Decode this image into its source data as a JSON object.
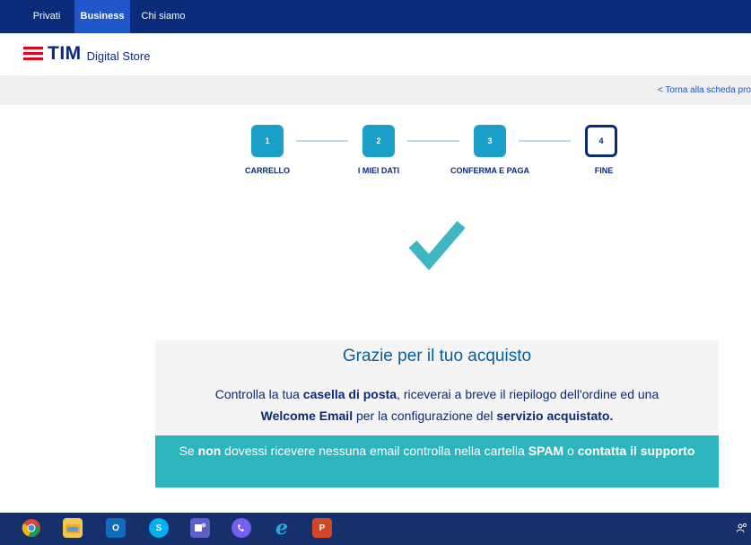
{
  "topnav": {
    "tabs": [
      {
        "label": "Privati"
      },
      {
        "label": "Business",
        "active": true
      },
      {
        "label": "Chi siamo"
      }
    ]
  },
  "brand": {
    "name": "TIM",
    "subtitle": "Digital Store",
    "color": "#0a2a7a",
    "accent": "#e3001b"
  },
  "back_link": {
    "label": "< Torna alla scheda pro"
  },
  "steps": [
    {
      "number": "1",
      "label": "CARRELLO",
      "state": "done"
    },
    {
      "number": "2",
      "label": "I MIEI DATI",
      "state": "done"
    },
    {
      "number": "3",
      "label": "CONFERMA E PAGA",
      "state": "done"
    },
    {
      "number": "4",
      "label": "FINE",
      "state": "current"
    }
  ],
  "success_icon": "check-icon",
  "confirmation": {
    "title": "Grazie per il tuo acquisto",
    "line1_a": "Controlla la tua ",
    "line1_b": "casella di posta",
    "line1_c": ", riceverai a breve il riepilogo dell'ordine ed una",
    "line2_a": "Welcome Email",
    "line2_b": " per la configurazione del ",
    "line2_c": "servizio acquistato.",
    "spam_a": "Se ",
    "spam_b": "non",
    "spam_c": " dovessi ricevere nessuna email controlla nella cartella ",
    "spam_d": "SPAM",
    "spam_e": " o ",
    "spam_f": "contatta il supporto"
  },
  "taskbar": {
    "apps": [
      {
        "icon": "chrome-icon"
      },
      {
        "icon": "file-explorer-icon"
      },
      {
        "icon": "outlook-icon",
        "text": "O"
      },
      {
        "icon": "skype-icon",
        "text": "S"
      },
      {
        "icon": "teams-icon"
      },
      {
        "icon": "viber-icon"
      },
      {
        "icon": "internet-explorer-icon",
        "text": "e"
      },
      {
        "icon": "powerpoint-icon",
        "text": "P"
      }
    ],
    "tray_icon": "people-icon"
  }
}
